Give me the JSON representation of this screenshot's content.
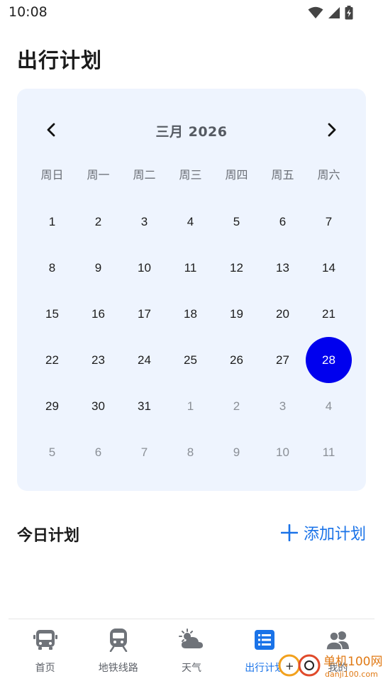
{
  "status_bar": {
    "time": "10:08",
    "icons": [
      "wifi-icon",
      "signal-icon",
      "battery-charging-icon"
    ]
  },
  "page": {
    "title": "出行计划"
  },
  "calendar": {
    "month_label": "三月 2026",
    "weekdays": [
      "周日",
      "周一",
      "周二",
      "周三",
      "周四",
      "周五",
      "周六"
    ],
    "days": [
      {
        "label": "1"
      },
      {
        "label": "2"
      },
      {
        "label": "3"
      },
      {
        "label": "4"
      },
      {
        "label": "5"
      },
      {
        "label": "6"
      },
      {
        "label": "7"
      },
      {
        "label": "8"
      },
      {
        "label": "9"
      },
      {
        "label": "10"
      },
      {
        "label": "11"
      },
      {
        "label": "12"
      },
      {
        "label": "13"
      },
      {
        "label": "14"
      },
      {
        "label": "15"
      },
      {
        "label": "16"
      },
      {
        "label": "17"
      },
      {
        "label": "18"
      },
      {
        "label": "19"
      },
      {
        "label": "20"
      },
      {
        "label": "21"
      },
      {
        "label": "22"
      },
      {
        "label": "23"
      },
      {
        "label": "24"
      },
      {
        "label": "25"
      },
      {
        "label": "26"
      },
      {
        "label": "27"
      },
      {
        "label": "28",
        "selected": true
      },
      {
        "label": "29"
      },
      {
        "label": "30"
      },
      {
        "label": "31"
      },
      {
        "label": "1",
        "muted": true
      },
      {
        "label": "2",
        "muted": true
      },
      {
        "label": "3",
        "muted": true
      },
      {
        "label": "4",
        "muted": true
      },
      {
        "label": "5",
        "muted": true
      },
      {
        "label": "6",
        "muted": true
      },
      {
        "label": "7",
        "muted": true
      },
      {
        "label": "8",
        "muted": true
      },
      {
        "label": "9",
        "muted": true
      },
      {
        "label": "10",
        "muted": true
      },
      {
        "label": "11",
        "muted": true
      }
    ],
    "selected_color": "#0000ee",
    "card_background": "#eef4fe"
  },
  "today": {
    "title": "今日计划",
    "add_label": "添加计划"
  },
  "bottom_nav": {
    "items": [
      {
        "label": "首页",
        "icon": "bus-icon"
      },
      {
        "label": "地铁线路",
        "icon": "subway-icon"
      },
      {
        "label": "天气",
        "icon": "weather-icon"
      },
      {
        "label": "出行计划",
        "icon": "list-icon",
        "active": true
      },
      {
        "label": "我的",
        "icon": "users-icon"
      }
    ],
    "active_color": "#1a73e8"
  },
  "watermark": {
    "text": "单机100网",
    "url_text": "danji100.com"
  }
}
